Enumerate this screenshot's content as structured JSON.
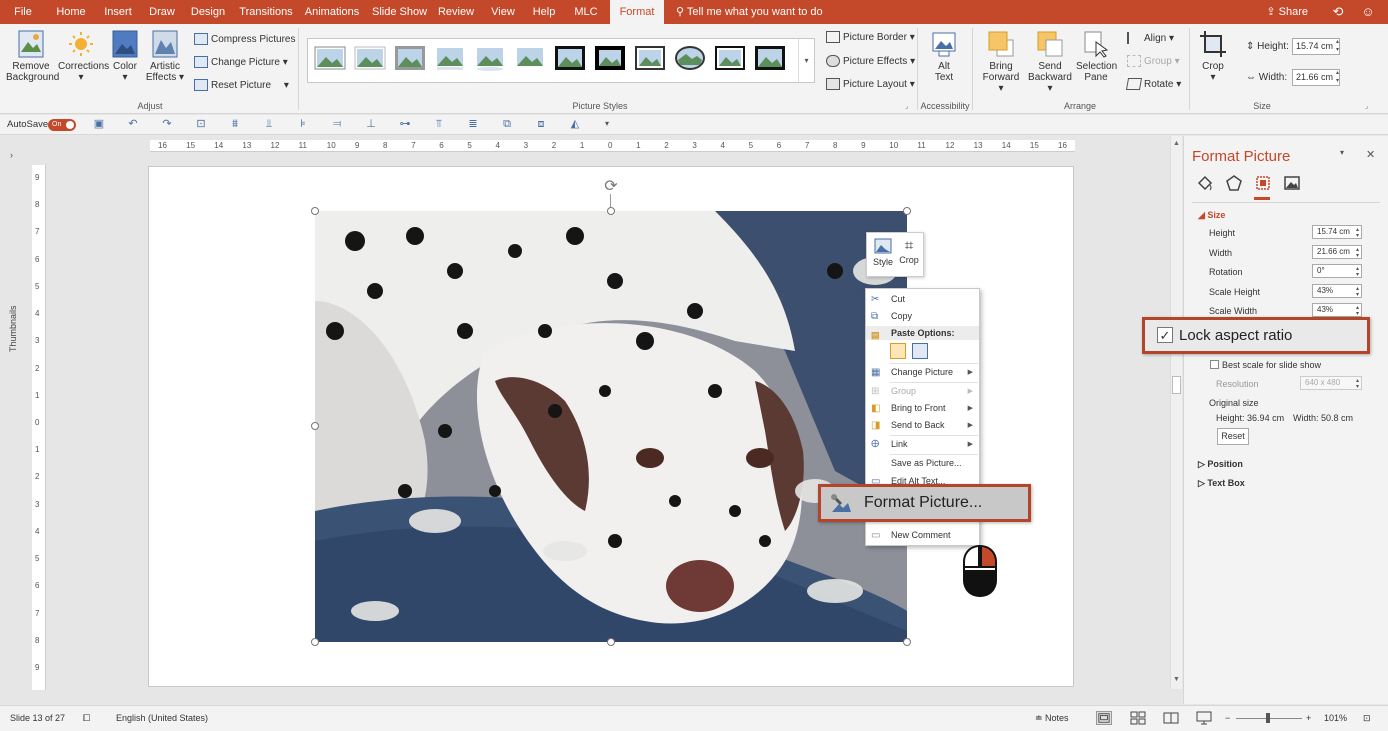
{
  "colors": {
    "accent": "#c4482a",
    "ribbon": "#f3f3f3",
    "canvas": "#e6e6e6"
  },
  "tabs": [
    "File",
    "Home",
    "Insert",
    "Draw",
    "Design",
    "Transitions",
    "Animations",
    "Slide Show",
    "Review",
    "View",
    "Help",
    "MLC",
    "Format"
  ],
  "active_tab": "Format",
  "tell_me": "Tell me what you want to do",
  "share": "Share",
  "ribbon": {
    "adjust": {
      "remove_background": [
        "Remove",
        "Background"
      ],
      "corrections": "Corrections",
      "color": "Color",
      "artistic_effects": [
        "Artistic",
        "Effects"
      ],
      "compress": "Compress Pictures",
      "change": "Change Picture",
      "reset": "Reset Picture",
      "label": "Adjust"
    },
    "picture_styles": {
      "label": "Picture Styles",
      "border": "Picture Border",
      "effects": "Picture Effects",
      "layout": "Picture Layout"
    },
    "accessibility": {
      "alt_text": [
        "Alt",
        "Text"
      ],
      "label": "Accessibility"
    },
    "arrange": {
      "bring_forward": [
        "Bring",
        "Forward"
      ],
      "send_backward": [
        "Send",
        "Backward"
      ],
      "selection_pane": [
        "Selection",
        "Pane"
      ],
      "align": "Align",
      "group": "Group",
      "rotate": "Rotate",
      "label": "Arrange"
    },
    "size": {
      "crop": "Crop",
      "height_label": "Height:",
      "height_value": "15.74 cm",
      "width_label": "Width:",
      "width_value": "21.66 cm",
      "label": "Size"
    }
  },
  "qat": {
    "autosave": "AutoSave",
    "toggle": "On"
  },
  "thumbnails": "Thumbnails",
  "ruler": {
    "h": [
      "16",
      "15",
      "14",
      "13",
      "12",
      "11",
      "10",
      "9",
      "8",
      "7",
      "6",
      "5",
      "4",
      "3",
      "2",
      "1",
      "0",
      "1",
      "2",
      "3",
      "4",
      "5",
      "6",
      "7",
      "8",
      "9",
      "10",
      "11",
      "12",
      "13",
      "14",
      "15",
      "16"
    ],
    "v": [
      "9",
      "8",
      "7",
      "6",
      "5",
      "4",
      "3",
      "2",
      "1",
      "0",
      "1",
      "2",
      "3",
      "4",
      "5",
      "6",
      "7",
      "8",
      "9"
    ]
  },
  "minibar": {
    "style": "Style",
    "crop": "Crop"
  },
  "context_menu": {
    "cut": "Cut",
    "copy": "Copy",
    "paste_options": "Paste Options:",
    "change_picture": "Change Picture",
    "group": "Group",
    "bring_to_front": "Bring to Front",
    "send_to_back": "Send to Back",
    "link": "Link",
    "save_as_picture": "Save as Picture...",
    "edit_alt_text": "Edit Alt Text...",
    "format_picture": "Format Picture...",
    "new_comment": "New Comment"
  },
  "pane": {
    "title": "Format Picture",
    "size_section": "Size",
    "height_label": "Height",
    "height_value": "15.74 cm",
    "width_label": "Width",
    "width_value": "21.66 cm",
    "rotation_label": "Rotation",
    "rotation_value": "0°",
    "scale_height_label": "Scale Height",
    "scale_height_value": "43%",
    "scale_width_label": "Scale Width",
    "scale_width_value": "43%",
    "lock_aspect": "Lock aspect ratio",
    "best_scale": "Best scale for slide show",
    "resolution_label": "Resolution",
    "resolution_value": "640 x 480",
    "original_size": "Original size",
    "orig_height_label": "Height:",
    "orig_height_value": "36.94 cm",
    "orig_width_label": "Width:",
    "orig_width_value": "50.8 cm",
    "reset": "Reset",
    "position": "Position",
    "text_box": "Text Box"
  },
  "status": {
    "slide": "Slide 13 of 27",
    "language": "English (United States)",
    "notes": "Notes",
    "zoom": "101%"
  }
}
